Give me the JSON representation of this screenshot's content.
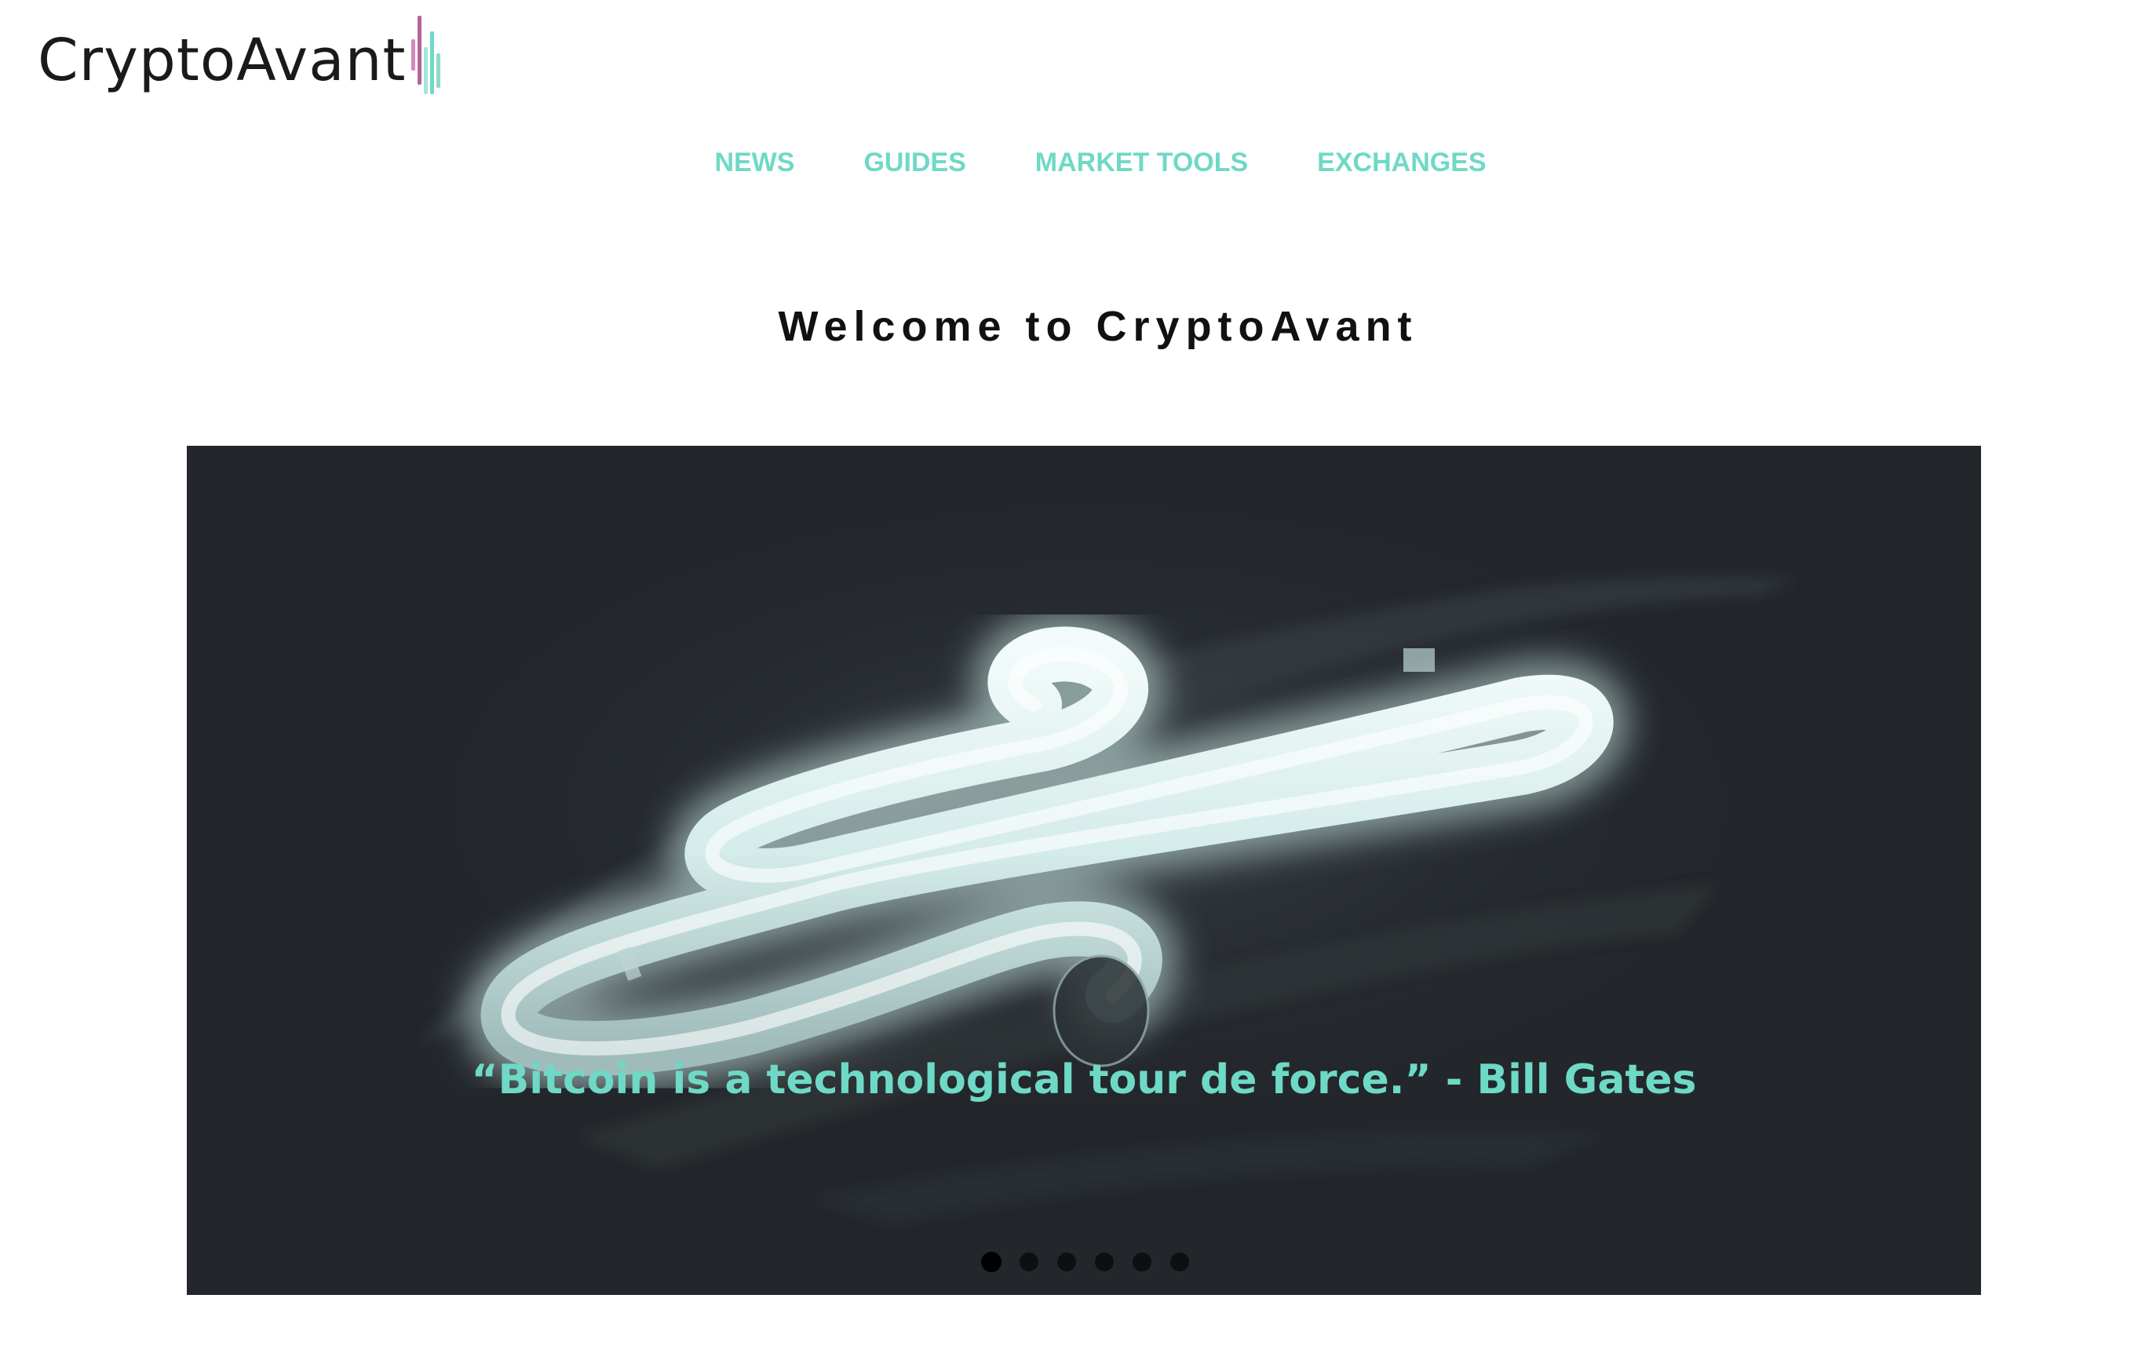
{
  "brand": {
    "name": "CryptoAvant",
    "mark_colors": [
      "#b4649a",
      "#d48ab8",
      "#8fd8cc",
      "#6ed9c6",
      "#a6e6dc"
    ]
  },
  "nav": {
    "items": [
      {
        "label": "NEWS"
      },
      {
        "label": "GUIDES"
      },
      {
        "label": "MARKET TOOLS"
      },
      {
        "label": "EXCHANGES"
      }
    ]
  },
  "main": {
    "title": "Welcome to CryptoAvant"
  },
  "hero": {
    "quote": "“Bitcoin is a technological tour de force.” - Bill Gates",
    "slide_count": 6,
    "active_slide": 1,
    "image_icon": "neon-tube-image"
  },
  "colors": {
    "accent": "#6ed9c6",
    "hero_bg": "#23272b",
    "text": "#111111"
  }
}
